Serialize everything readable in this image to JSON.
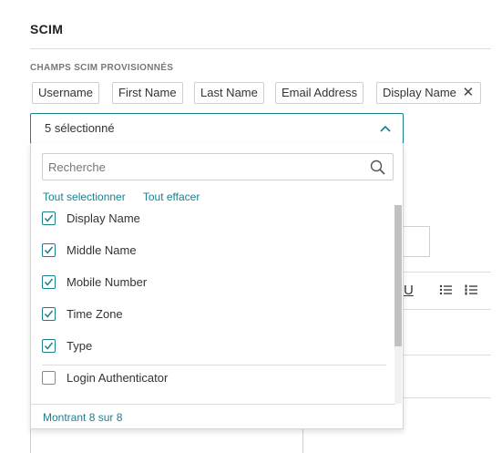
{
  "section": {
    "title": "SCIM"
  },
  "field": {
    "label": "CHAMPS SCIM PROVISIONNÉS"
  },
  "chips": [
    {
      "label": "Username"
    },
    {
      "label": "First Name"
    },
    {
      "label": "Last Name"
    },
    {
      "label": "Email Address"
    },
    {
      "label": "Display Name",
      "removable": true
    }
  ],
  "select": {
    "value": "5 sélectionné",
    "expanded": true
  },
  "dropdown": {
    "search_placeholder": "Recherche",
    "select_all": "Tout selectionner",
    "clear_all": "Tout effacer",
    "options": [
      {
        "label": "Display Name",
        "checked": true
      },
      {
        "label": "Middle Name",
        "checked": true
      },
      {
        "label": "Mobile Number",
        "checked": true
      },
      {
        "label": "Time Zone",
        "checked": true
      },
      {
        "label": "Type",
        "checked": true
      },
      {
        "label": "Login Authenticator",
        "checked": false
      }
    ],
    "footer": "Montrant 8 sur 8"
  },
  "background_toolbar": {
    "underline_glyph": "U",
    "bullet_list_icon": "bullet-list-icon",
    "numbered_list_icon": "numbered-list-icon"
  },
  "colors": {
    "accent": "#1b7f8e",
    "border": "#cfcfcf",
    "text": "#333333",
    "muted": "#777777"
  }
}
